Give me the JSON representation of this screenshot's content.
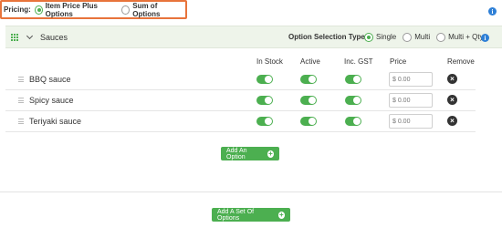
{
  "pricing": {
    "label": "Pricing:",
    "options": [
      {
        "label": "Item Price Plus Options",
        "selected": true
      },
      {
        "label": "Sum of Options",
        "selected": false
      }
    ]
  },
  "section": {
    "title": "Sauces",
    "option_selection_label": "Option Selection Type:",
    "selection_types": [
      {
        "label": "Single",
        "selected": true
      },
      {
        "label": "Multi",
        "selected": false
      },
      {
        "label": "Multi + Qty",
        "selected": false
      }
    ]
  },
  "columns": {
    "in_stock": "In Stock",
    "active": "Active",
    "inc_gst": "Inc. GST",
    "price": "Price",
    "remove": "Remove"
  },
  "options": [
    {
      "name": "BBQ sauce",
      "in_stock": true,
      "active": true,
      "inc_gst": true,
      "price_placeholder": "$ 0.00"
    },
    {
      "name": "Spicy sauce",
      "in_stock": true,
      "active": true,
      "inc_gst": true,
      "price_placeholder": "$ 0.00"
    },
    {
      "name": "Teriyaki sauce",
      "in_stock": true,
      "active": true,
      "inc_gst": true,
      "price_placeholder": "$ 0.00"
    }
  ],
  "buttons": {
    "add_option": "Add An Option",
    "add_set": "Add A Set Of Options"
  },
  "icons": {
    "info": "i",
    "remove": "×",
    "plus": "+"
  },
  "colors": {
    "accent_green": "#4caf50",
    "highlight_orange": "#e8743b",
    "info_blue": "#2d7fd6"
  }
}
